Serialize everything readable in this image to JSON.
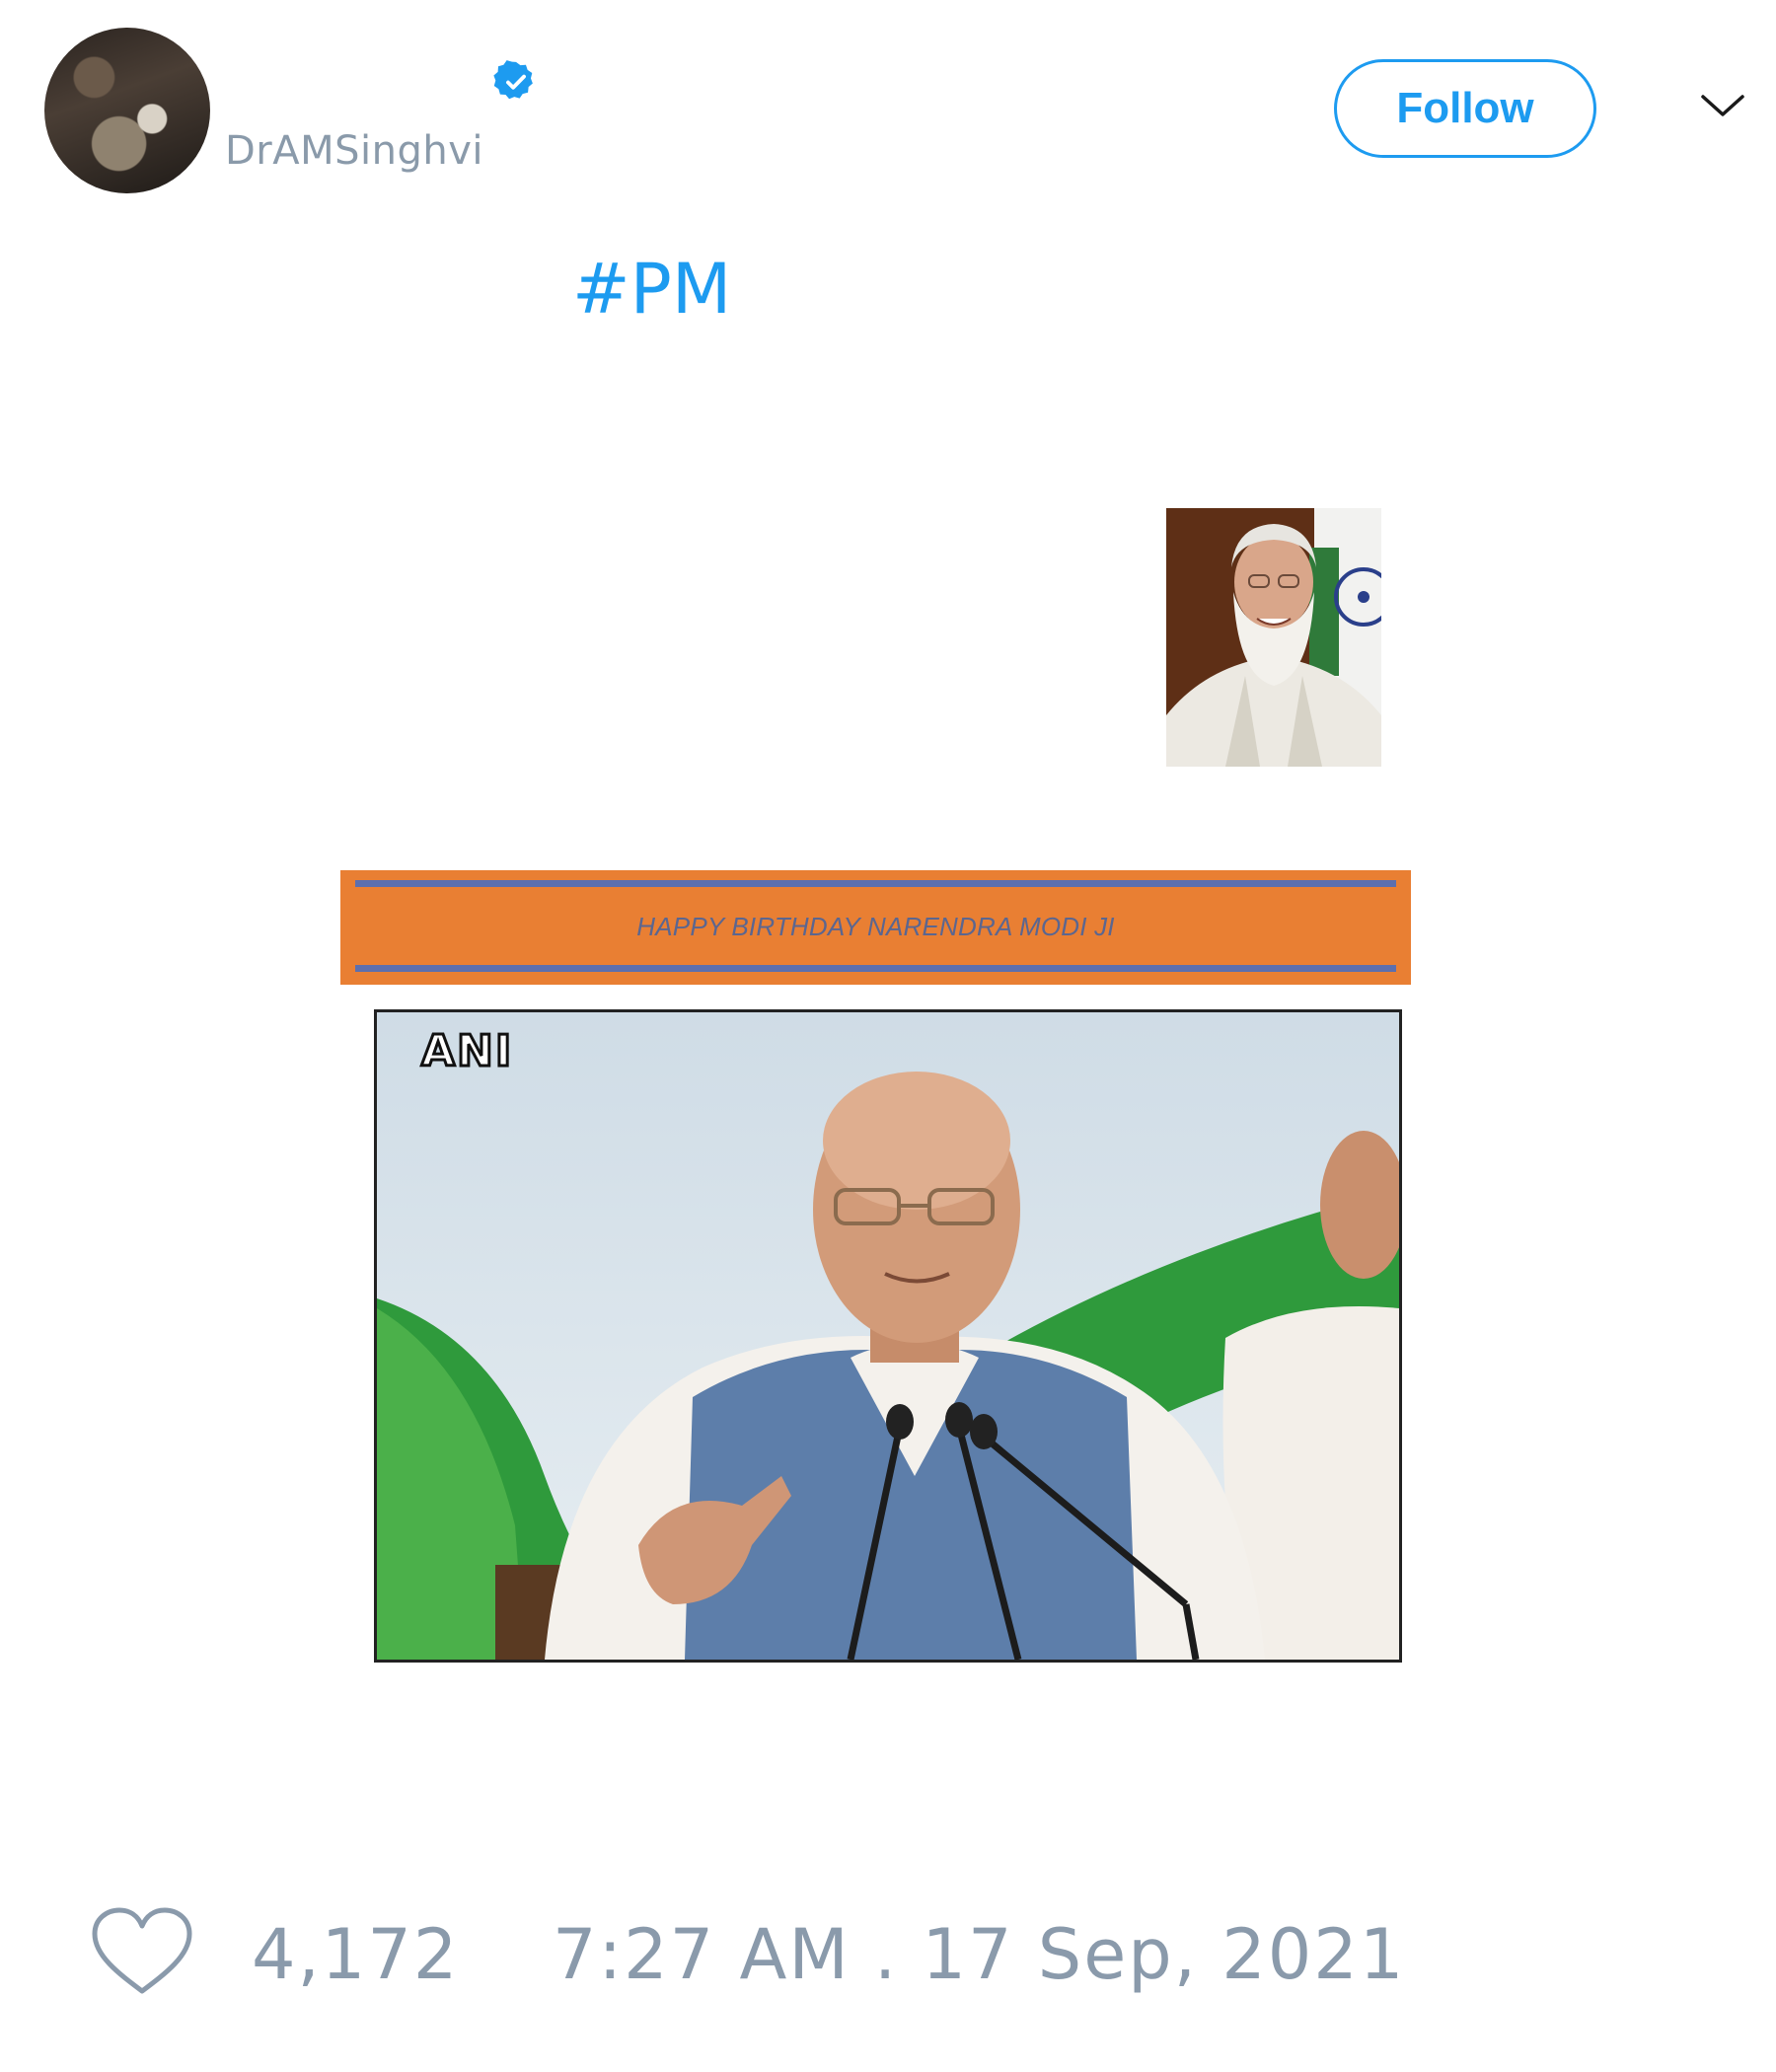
{
  "author": {
    "handle": "DrAMSinghvi",
    "verified_icon": "verified-badge-icon",
    "avatar": "avatar"
  },
  "header": {
    "follow_label": "Follow",
    "menu_icon": "chevron-down-icon"
  },
  "tweet": {
    "hashtag": "#PM"
  },
  "media": {
    "banner_text": "HAPPY BIRTHDAY NARENDRA MODI JI",
    "watermark": "ANI"
  },
  "footer": {
    "like_icon": "heart-icon",
    "like_count": "4,172",
    "timestamp": "7:27 AM . 17 Sep, 2021"
  },
  "colors": {
    "accent": "#1d9bf0",
    "muted": "#8a9aab",
    "banner_orange": "#e97f33",
    "banner_line": "#5c6fae"
  }
}
